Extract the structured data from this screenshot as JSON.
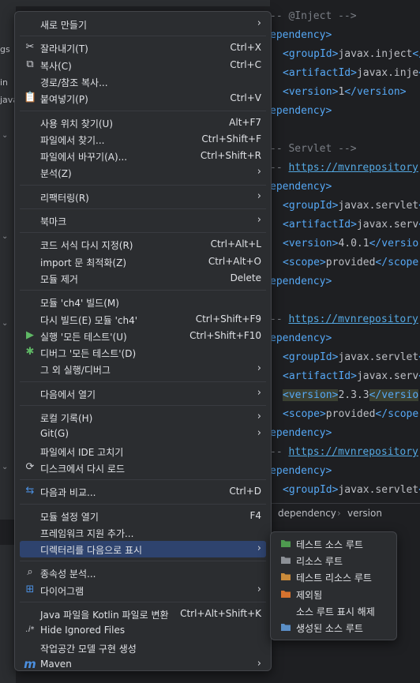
{
  "editor": {
    "lines": [
      {
        "kind": "comment",
        "text": "-- @Inject -->"
      },
      {
        "kind": "tagline",
        "text": "ependency>"
      },
      {
        "kind": "elem",
        "tag": "groupId",
        "value": "javax.inject"
      },
      {
        "kind": "elem",
        "tag": "artifactId",
        "value": "javax.inje"
      },
      {
        "kind": "elem",
        "tag": "version",
        "value": "1",
        "close": "version>"
      },
      {
        "kind": "tagline",
        "text": "ependency>"
      },
      {
        "kind": "blank",
        "text": ""
      },
      {
        "kind": "comment",
        "text": "-- Servlet -->"
      },
      {
        "kind": "link",
        "prefix": "-- ",
        "text": "https://mvnrepository"
      },
      {
        "kind": "tagline",
        "text": "ependency>"
      },
      {
        "kind": "elem",
        "tag": "groupId",
        "value": "javax.servlet"
      },
      {
        "kind": "elem",
        "tag": "artifactId",
        "value": "javax.serv"
      },
      {
        "kind": "elem",
        "tag": "version",
        "value": "4.0.1",
        "close": "versio"
      },
      {
        "kind": "elem",
        "tag": "scope",
        "value": "provided",
        "close": "scope"
      },
      {
        "kind": "tagline",
        "text": "ependency>"
      },
      {
        "kind": "blank",
        "text": ""
      },
      {
        "kind": "link",
        "prefix": "-- ",
        "text": "https://mvnrepository"
      },
      {
        "kind": "tagline",
        "text": "ependency>"
      },
      {
        "kind": "elem",
        "tag": "groupId",
        "value": "javax.servlet"
      },
      {
        "kind": "elem",
        "tag": "artifactId",
        "value": "javax.serv"
      },
      {
        "kind": "elem",
        "tag": "version",
        "value": "2.3.3",
        "close": "versio",
        "highlight": true
      },
      {
        "kind": "elem",
        "tag": "scope",
        "value": "provided",
        "close": "scope"
      },
      {
        "kind": "tagline",
        "text": "ependency>"
      },
      {
        "kind": "link",
        "prefix": "-- ",
        "text": "https://mvnrepository"
      },
      {
        "kind": "tagline",
        "text": "ependency>"
      },
      {
        "kind": "elem",
        "tag": "groupId",
        "value": "javax.servlet"
      }
    ],
    "breadcrumb": [
      "dependency",
      "version"
    ]
  },
  "left_panel": {
    "fragments": [
      "gs",
      "in",
      "java"
    ]
  },
  "menu": {
    "items": [
      {
        "label": "새로 만들기",
        "submenu": true
      },
      {
        "sep": true
      },
      {
        "label": "잘라내기(T)",
        "shortcut": "Ctrl+X",
        "icon": "scissors-icon",
        "glyph": "✂"
      },
      {
        "label": "복사(C)",
        "shortcut": "Ctrl+C",
        "icon": "copy-icon",
        "glyph": "⧉"
      },
      {
        "label": "경로/참조 복사..."
      },
      {
        "label": "붙여넣기(P)",
        "shortcut": "Ctrl+V",
        "icon": "paste-icon",
        "glyph": "📋"
      },
      {
        "sep": true
      },
      {
        "label": "사용 위치 찾기(U)",
        "shortcut": "Alt+F7"
      },
      {
        "label": "파일에서 찾기...",
        "shortcut": "Ctrl+Shift+F"
      },
      {
        "label": "파일에서 바꾸기(A)...",
        "shortcut": "Ctrl+Shift+R"
      },
      {
        "label": "분석(Z)",
        "submenu": true
      },
      {
        "sep": true
      },
      {
        "label": "리팩터링(R)",
        "submenu": true
      },
      {
        "sep": true
      },
      {
        "label": "북마크",
        "submenu": true
      },
      {
        "sep": true
      },
      {
        "label": "코드 서식 다시 지정(R)",
        "shortcut": "Ctrl+Alt+L"
      },
      {
        "label": "import 문 최적화(Z)",
        "shortcut": "Ctrl+Alt+O"
      },
      {
        "label": "모듈 제거",
        "shortcut": "Delete"
      },
      {
        "sep": true
      },
      {
        "label": "모듈 'ch4' 빌드(M)"
      },
      {
        "label": "다시 빌드(E) 모듈 'ch4'",
        "shortcut": "Ctrl+Shift+F9"
      },
      {
        "label": "실행 '모든 테스트'(U)",
        "shortcut": "Ctrl+Shift+F10",
        "icon": "run-icon",
        "glyph": "▶",
        "color": "#5fb865"
      },
      {
        "label": "디버그 '모든 테스트'(D)",
        "icon": "debug-icon",
        "glyph": "✱",
        "color": "#5fb865"
      },
      {
        "label": "그 외 실행/디버그",
        "submenu": true
      },
      {
        "sep": true
      },
      {
        "label": "다음에서 열기",
        "submenu": true
      },
      {
        "sep": true
      },
      {
        "label": "로컬 기록(H)",
        "submenu": true
      },
      {
        "label": "Git(G)",
        "submenu": true
      },
      {
        "label": "파일에서 IDE 고치기"
      },
      {
        "label": "디스크에서 다시 로드",
        "icon": "reload-icon",
        "glyph": "⟳"
      },
      {
        "sep": true
      },
      {
        "label": "다음과 비교...",
        "shortcut": "Ctrl+D",
        "icon": "compare-icon",
        "glyph": "⇆",
        "color": "#4b8fe0"
      },
      {
        "sep": true
      },
      {
        "label": "모듈 설정 열기",
        "shortcut": "F4"
      },
      {
        "label": "프레임워크 지원 추가..."
      },
      {
        "label": "디렉터리를 다음으로 표시",
        "submenu": true,
        "active": true
      },
      {
        "sep": true
      },
      {
        "label": "종속성 분석...",
        "icon": "analyze-icon",
        "glyph": "⌕"
      },
      {
        "label": "다이어그램",
        "submenu": true,
        "icon": "diagram-icon",
        "glyph": "⊞",
        "color": "#4b8fe0"
      },
      {
        "sep": true
      },
      {
        "label": "Java 파일을 Kotlin 파일로 변환",
        "shortcut": "Ctrl+Alt+Shift+K"
      },
      {
        "label": "Hide Ignored Files",
        "icon": "ignore-icon",
        "glyph": ".i*"
      },
      {
        "label": "작업공간 모델 구현 생성"
      },
      {
        "label": "Maven",
        "submenu": true,
        "icon": "maven-icon",
        "glyph": "m",
        "color": "#4b8fe0"
      }
    ]
  },
  "submenu": {
    "items": [
      {
        "label": "테스트 소스 루트",
        "icon": "test-source-root-icon",
        "color": "#4e9a4f"
      },
      {
        "label": "리소스 루트",
        "icon": "resources-root-icon",
        "color": "#8c9096"
      },
      {
        "label": "테스트 리소스 루트",
        "icon": "test-resources-root-icon",
        "color": "#c98a3a"
      },
      {
        "label": "제외됨",
        "icon": "excluded-icon",
        "color": "#d6722e"
      },
      {
        "label": "소스 루트 표시 해제",
        "icon": ""
      },
      {
        "label": "생성된 소스 루트",
        "icon": "generated-source-root-icon",
        "color": "#5b8fc7"
      }
    ]
  }
}
